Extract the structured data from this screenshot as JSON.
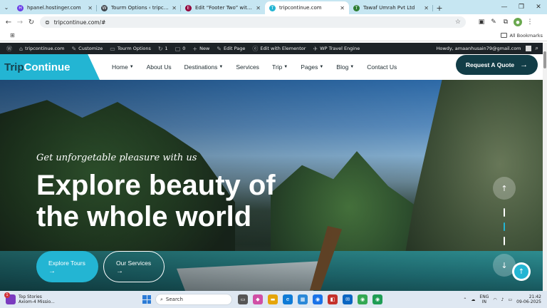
{
  "browser": {
    "tabs": [
      {
        "title": "hpanel.hostinger.com",
        "fav_color": "#673de6",
        "fav_glyph": "H"
      },
      {
        "title": "Tourm Options ‹ tripcontinue.co",
        "fav_color": "#3c434a",
        "fav_glyph": "W"
      },
      {
        "title": "Edit “Footer Two” with Elementor",
        "fav_color": "#92003b",
        "fav_glyph": "E"
      },
      {
        "title": "tripcontinue.com",
        "fav_color": "#23b5d3",
        "fav_glyph": "T"
      },
      {
        "title": "Tawaf Umrah Pvt Ltd",
        "fav_color": "#2e7d32",
        "fav_glyph": "T"
      }
    ],
    "active_tab_index": 3,
    "url": "tripcontinue.com/#",
    "all_bookmarks": "All Bookmarks"
  },
  "wp_admin": {
    "site": "tripcontinue.com",
    "customize": "Customize",
    "tourm_options": "Tourm Options",
    "updates_count": "1",
    "comments_count": "0",
    "new": "New",
    "edit_page": "Edit Page",
    "edit_elementor": "Edit with Elementor",
    "wp_travel_engine": "WP Travel Engine",
    "howdy": "Howdy, amaanhusain79@gmail.com"
  },
  "site": {
    "logo_part1": "Trip",
    "logo_part2": "Continue",
    "nav": [
      {
        "label": "Home",
        "dropdown": true
      },
      {
        "label": "About Us",
        "dropdown": false
      },
      {
        "label": "Destinations",
        "dropdown": true
      },
      {
        "label": "Services",
        "dropdown": false
      },
      {
        "label": "Trip",
        "dropdown": true
      },
      {
        "label": "Pages",
        "dropdown": true
      },
      {
        "label": "Blog",
        "dropdown": true
      },
      {
        "label": "Contact Us",
        "dropdown": false
      }
    ],
    "cta": "Request A Quote",
    "colors": {
      "accent": "#23b5d3",
      "dark": "#123d47"
    }
  },
  "hero": {
    "tagline": "Get unforgetable pleasure with us",
    "title_line1": "Explore beauty of",
    "title_line2": "the whole world",
    "btn_primary": "Explore Tours",
    "btn_secondary": "Our Services",
    "slide_count": 3,
    "active_slide": 2
  },
  "taskbar": {
    "news_title": "Top Stories",
    "news_sub": "Axiom-4 Missio...",
    "news_badge": "1",
    "search_placeholder": "Search",
    "lang_line1": "ENG",
    "lang_line2": "IN",
    "time": "21:42",
    "date": "09-06-2025"
  }
}
